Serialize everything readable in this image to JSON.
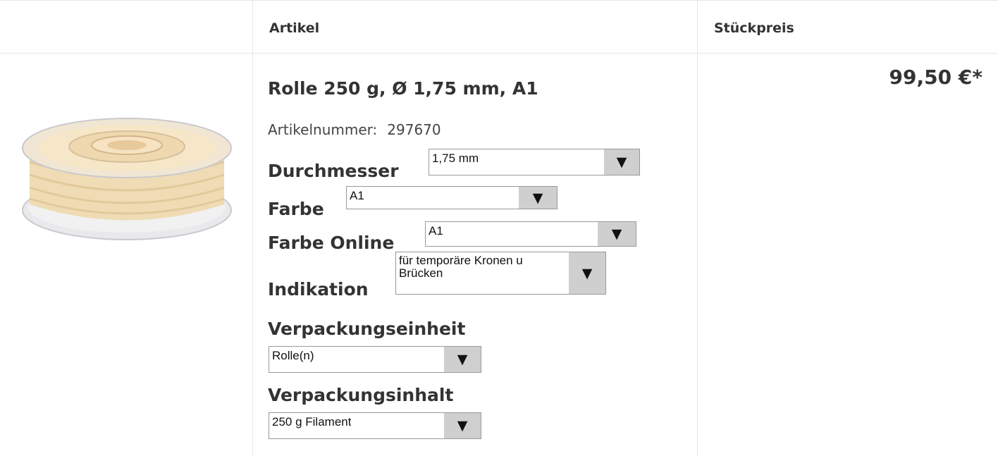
{
  "table": {
    "headers": {
      "article": "Artikel",
      "unit_price": "Stückpreis"
    }
  },
  "product": {
    "title": "Rolle 250 g, Ø 1,75 mm, A1",
    "article_number_label": "Artikelnummer:",
    "article_number": "297670",
    "price": "99,50 €*",
    "image_alt": "Filament spool"
  },
  "options": {
    "durchmesser": {
      "label": "Durchmesser",
      "value": "1,75 mm"
    },
    "farbe": {
      "label": "Farbe",
      "value": "A1"
    },
    "farbe_online": {
      "label": "Farbe Online",
      "value": "A1"
    },
    "indikation": {
      "label": "Indikation",
      "value": "für temporäre Kronen u Brücken"
    },
    "verpackungseinheit": {
      "label": "Verpackungseinheit",
      "value": "Rolle(n)"
    },
    "verpackungsinhalt": {
      "label": "Verpackungsinhalt",
      "value": "250 g Filament"
    }
  },
  "icons": {
    "dropdown": "triangle-down-icon"
  },
  "colors": {
    "border": "#e6e6e6",
    "arrow_bg": "#cfcfcf",
    "spool": "#f4e6c8"
  }
}
